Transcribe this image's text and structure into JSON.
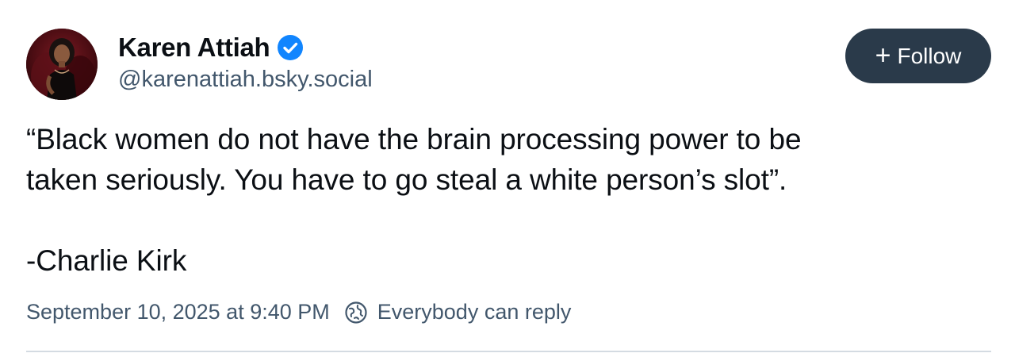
{
  "author": {
    "display_name": "Karen Attiah",
    "handle": "@karenattiah.bsky.social",
    "verified": true,
    "avatar": "avatar-photo"
  },
  "follow_button": {
    "label": "Follow",
    "icon": "plus-icon"
  },
  "post": {
    "lines": [
      "“Black women do not have the brain processing power to be",
      "taken seriously. You have to go steal a white person’s slot”.",
      "-Charlie Kirk"
    ]
  },
  "meta": {
    "timestamp": "September 10, 2025 at 9:40 PM",
    "reply_setting": "Everybody can reply",
    "reply_icon": "globe-icon"
  },
  "colors": {
    "verified_badge": "#1185fe",
    "follow_button_bg": "#2a3a4a",
    "secondary_text": "#42576c",
    "divider": "#d4dbe2"
  }
}
